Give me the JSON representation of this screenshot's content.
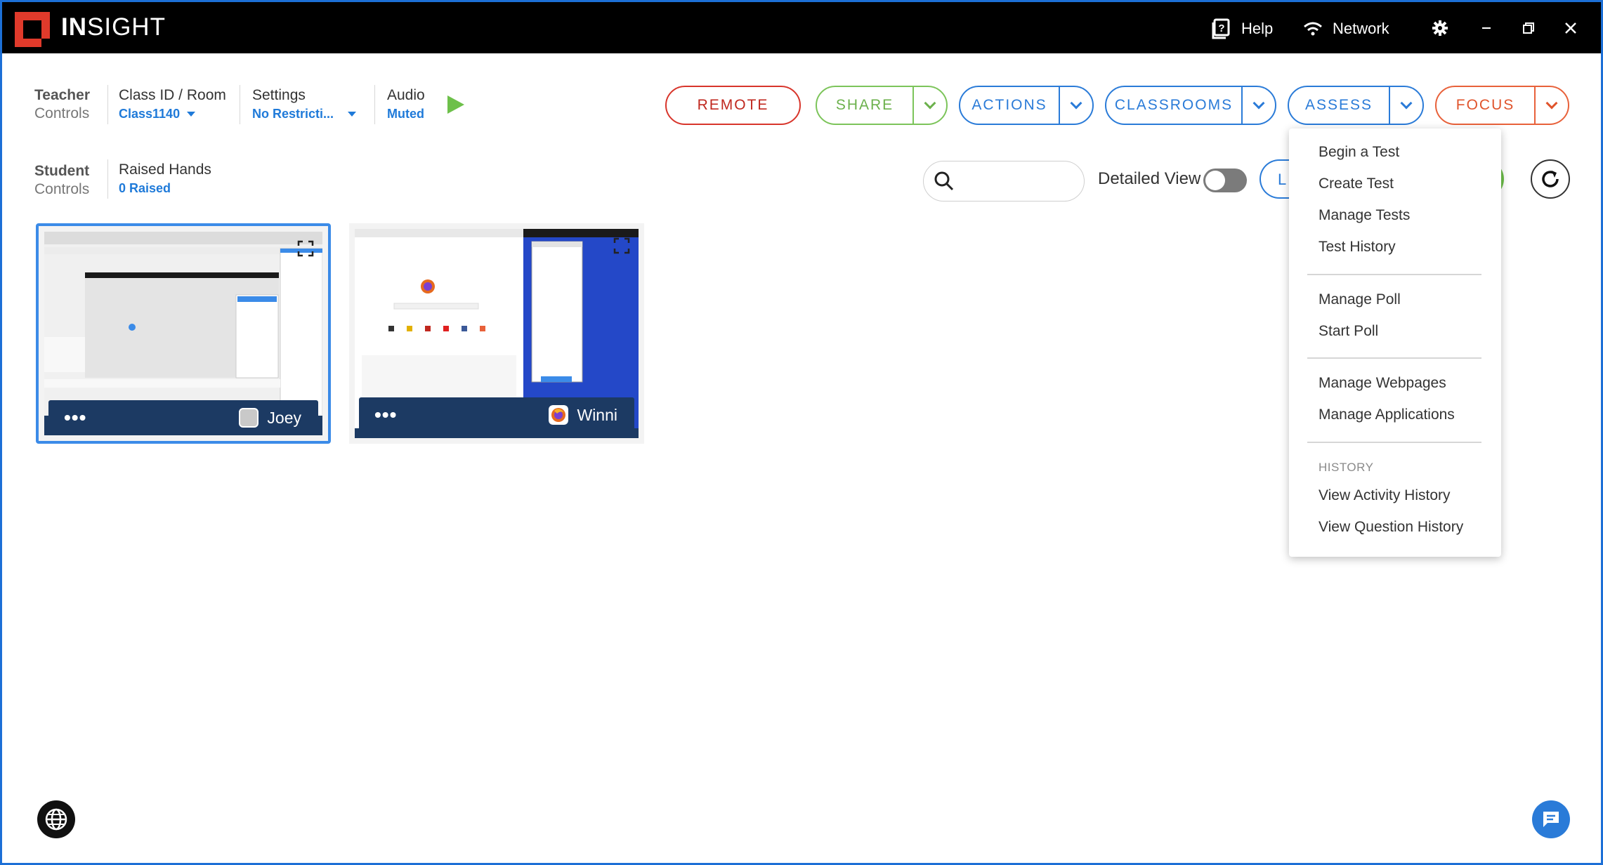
{
  "app": {
    "brand_bold": "IN",
    "brand_rest": "SIGHT"
  },
  "titlebar": {
    "help_label": "Help",
    "network_label": "Network"
  },
  "teacher": {
    "title": "Teacher",
    "subtitle": "Controls",
    "class_label": "Class ID / Room",
    "class_value": "Class1140",
    "settings_label": "Settings",
    "settings_value": "No Restricti...",
    "audio_label": "Audio",
    "audio_value": "Muted"
  },
  "toolbar": {
    "remote": "REMOTE",
    "share": "SHARE",
    "actions": "ACTIONS",
    "classrooms": "CLASSROOMS",
    "assess": "ASSESS",
    "focus": "FOCUS"
  },
  "student": {
    "title": "Student",
    "subtitle": "Controls",
    "raised_label": "Raised Hands",
    "raised_value": "0 Raised",
    "detailed_view_label": "Detailed View",
    "detailed_view_on": false,
    "partial_button_text": "L"
  },
  "thumbnails": [
    {
      "name": "Joey",
      "selected": true,
      "app_icon": "app-icon"
    },
    {
      "name": "Winni",
      "selected": false,
      "app_icon": "firefox-icon"
    }
  ],
  "assess_menu": {
    "items_group1": [
      "Begin a Test",
      "Create Test",
      "Manage Tests",
      "Test History"
    ],
    "items_group2": [
      "Manage Poll",
      "Start Poll"
    ],
    "items_group3": [
      "Manage Webpages",
      "Manage Applications"
    ],
    "history_header": "HISTORY",
    "items_group4": [
      "View Activity History",
      "View Question History"
    ]
  },
  "colors": {
    "accent_blue": "#2a7bd8",
    "remote_red": "#d8352b",
    "share_green": "#7cc45a",
    "focus_orange": "#e8613a",
    "thumb_bar": "#1c3a63"
  }
}
